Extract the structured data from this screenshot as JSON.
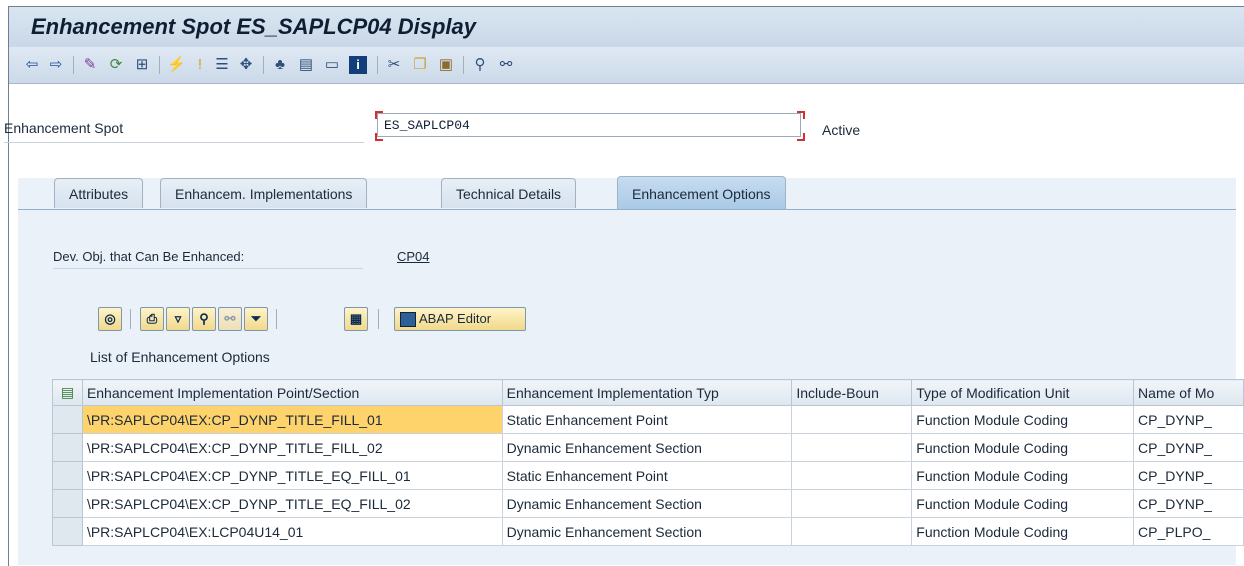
{
  "window": {
    "title": "Enhancement Spot ES_SAPLCP04 Display"
  },
  "toolbar": {
    "icons": [
      "back-arrow-icon",
      "forward-arrow-icon",
      "display-change-icon",
      "other-object-icon",
      "check-icon",
      "activate-icon",
      "where-used-icon",
      "display-object-list-icon",
      "navigation-window-icon",
      "hierarchy-icon",
      "attributes-icon",
      "display-frame-icon",
      "info-icon",
      "cut-icon",
      "copy-icon",
      "paste-icon",
      "find-icon",
      "find-next-icon"
    ]
  },
  "header": {
    "spot_label": "Enhancement Spot",
    "spot_value": "ES_SAPLCP04",
    "status": "Active"
  },
  "tabs": [
    {
      "label": "Attributes"
    },
    {
      "label": "Enhancem. Implementations"
    },
    {
      "label": "Technical Details"
    },
    {
      "label": "Enhancement Options"
    }
  ],
  "active_tab": "Enhancement Options",
  "devobj": {
    "label": "Dev. Obj. that Can Be Enhanced:",
    "value": "CP04"
  },
  "grid_toolbar": {
    "buttons": [
      "details-icon",
      "print-icon",
      "filter-icon",
      "find-icon",
      "find-next-icon",
      "set-filter-icon",
      "layout-icon"
    ],
    "abap_editor_label": "ABAP Editor"
  },
  "list": {
    "title": "List of Enhancement Options",
    "columns": [
      "Enhancement Implementation Point/Section",
      "Enhancement Implementation Typ",
      "Include-Boun",
      "Type of Modification Unit",
      "Name of Mo"
    ],
    "rows": [
      {
        "point": "\\PR:SAPLCP04\\EX:CP_DYNP_TITLE_FILL_01",
        "type": "Static Enhancement Point",
        "include": "",
        "mod_type": "Function Module Coding",
        "name": "CP_DYNP_"
      },
      {
        "point": "\\PR:SAPLCP04\\EX:CP_DYNP_TITLE_FILL_02",
        "type": "Dynamic Enhancement Section",
        "include": "",
        "mod_type": "Function Module Coding",
        "name": "CP_DYNP_"
      },
      {
        "point": "\\PR:SAPLCP04\\EX:CP_DYNP_TITLE_EQ_FILL_01",
        "type": "Static Enhancement Point",
        "include": "",
        "mod_type": "Function Module Coding",
        "name": "CP_DYNP_"
      },
      {
        "point": "\\PR:SAPLCP04\\EX:CP_DYNP_TITLE_EQ_FILL_02",
        "type": "Dynamic Enhancement Section",
        "include": "",
        "mod_type": "Function Module Coding",
        "name": "CP_DYNP_"
      },
      {
        "point": "\\PR:SAPLCP04\\EX:LCP04U14_01",
        "type": "Dynamic Enhancement Section",
        "include": "",
        "mod_type": "Function Module Coding",
        "name": "CP_PLPO_"
      }
    ]
  },
  "colors": {
    "title_bg": "#cfdcea",
    "active_tab": "#b4d0ea",
    "highlight_cell": "#ffd36b",
    "button_fill": "#f6e3a2"
  }
}
